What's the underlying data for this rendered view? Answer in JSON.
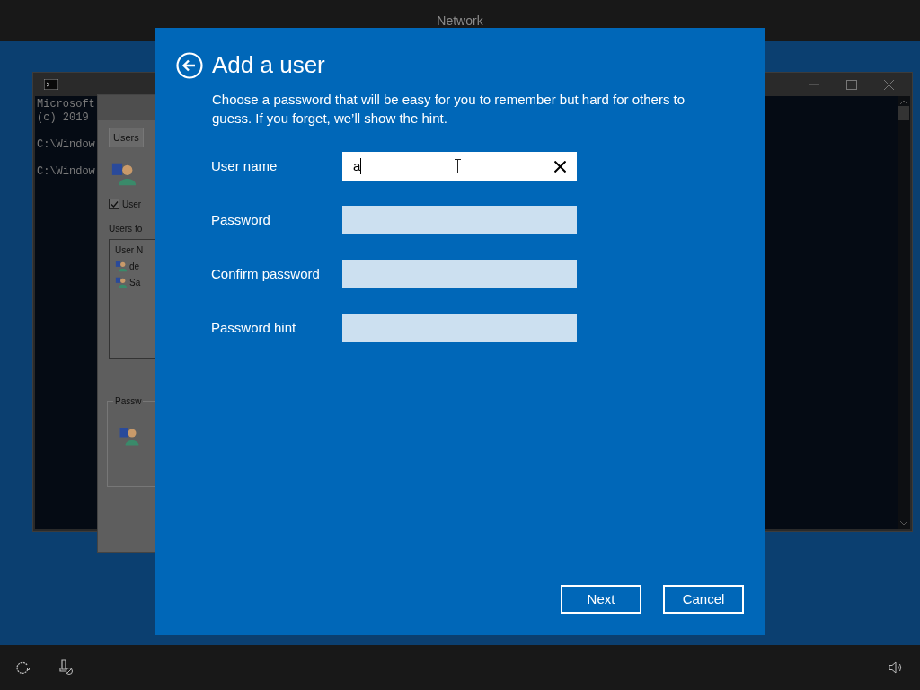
{
  "top_bar": {
    "title": "Network"
  },
  "console_window": {
    "blocks": [
      [
        "Microsoft",
        "(c) 2019"
      ],
      [
        "C:\\Window"
      ],
      [
        "C:\\Window"
      ]
    ]
  },
  "user_accounts_window": {
    "tabs": [
      {
        "label": "Users",
        "selected": true
      }
    ],
    "checkbox": {
      "label": "User",
      "checked": true
    },
    "list_label": "Users fo",
    "list_header": "User N",
    "users": [
      "de",
      "Sa"
    ],
    "group_label": "Passw"
  },
  "dialog": {
    "title": "Add a user",
    "description": "Choose a password that will be easy for you to remember but hard for others to guess. If you forget, we’ll show the hint.",
    "fields": [
      {
        "label": "User name",
        "value": "a",
        "focused": true
      },
      {
        "label": "Password",
        "focused": false
      },
      {
        "label": "Confirm password",
        "focused": false
      },
      {
        "label": "Password hint",
        "focused": false
      }
    ],
    "buttons": [
      "Next",
      "Cancel"
    ]
  }
}
